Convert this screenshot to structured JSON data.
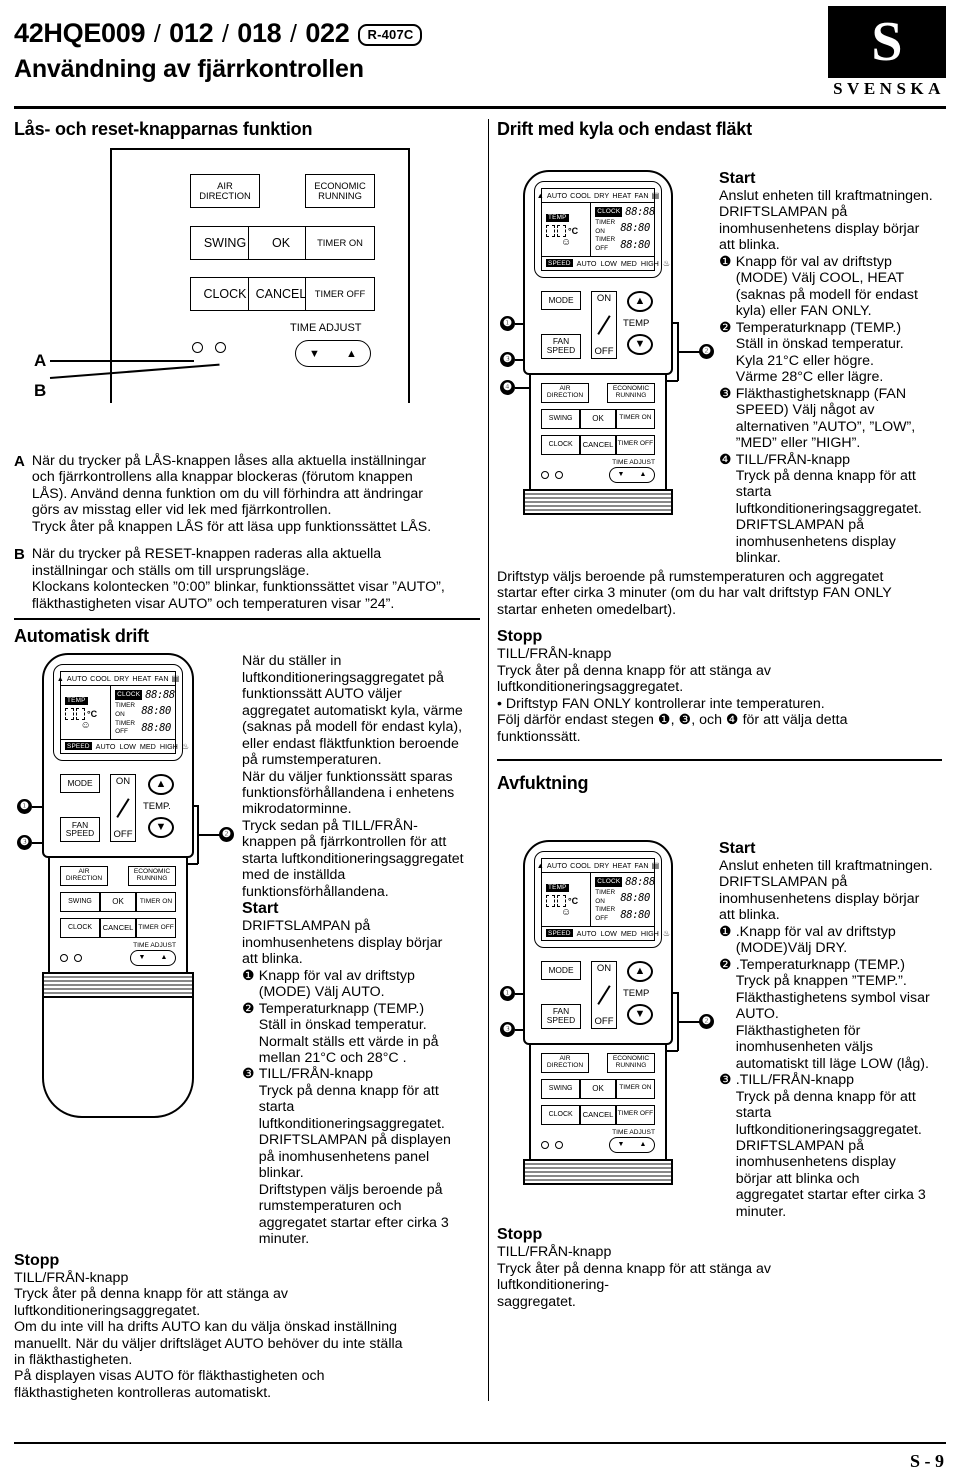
{
  "header": {
    "model": "42HQE009 / 012 / 018 / 022",
    "model_parts": [
      "42HQE009",
      "012",
      "018",
      "022"
    ],
    "refrigerant": "R-407C",
    "subtitle": "Användning av fjärrkontrollen",
    "logo_letter": "S",
    "logo_word": "SVENSKA"
  },
  "left": {
    "section1_title": "Lås- och reset-knapparnas funktion",
    "lock_panel": {
      "buttons": [
        "AIR DIRECTION",
        "ECONOMIC RUNNING",
        "SWING",
        "OK",
        "TIMER ON",
        "CLOCK",
        "CANCEL",
        "TIMER OFF"
      ],
      "air_direction": "AIR\nDIRECTION",
      "economic_running": "ECONOMIC\nRUNNING",
      "swing": "SWING",
      "ok": "OK",
      "timer_on": "TIMER ON",
      "clock": "CLOCK",
      "cancel": "CANCEL",
      "timer_off": "TIMER OFF",
      "time_adjust": "TIME ADJUST",
      "arrow_down": "▼",
      "arrow_up": "▲",
      "label_a": "A",
      "label_b": "B"
    },
    "note_a_label": "A",
    "note_a": "När du trycker på LÅS-knappen låses alla aktuella inställningar\noch fjärrkontrollens alla knappar blockeras (förutom knappen\nLÅS). Använd denna funktion om du vill förhindra att  ändringar\ngörs av misstag eller vid lek med fjärrkontrollen.\nTryck  åter på  knappen LÅS för att läsa upp funktionssättet LÅS.",
    "note_b_label": "B",
    "note_b": "När du trycker på  RESET-knappen raderas alla aktuella\ninställningar och ställs om till ursprungsläge.\nKlockans kolontecken ”0:00” blinkar, funktionssättet visar ”AUTO”,\nfläkthastigheten visar  AUTO” och temperaturen visar ”24”.",
    "section2_title": "Automatisk drift",
    "auto_intro": "När du ställer in\nluftkonditioneringsaggregatet på\nfunktionssätt AUTO väljer\naggregatet automatiskt kyla, värme\n(saknas på  modell för endast kyla),\neller endast fläktfunktion beroende\npå  rumstemperaturen.\nNär du väljer funktionssätt sparas\nfunktionsförhållandena i enhetens\nmikrodatorminne.\nTryck sedan på  TILL/FRÅN-\nknappen på  fjärrkontrollen för att\nstarta  luftkonditioneringsaggregatet\nmed de inställda\nfunktionsförhållandena.",
    "start_label": "Start",
    "start_intro": "DRIFTSLAMPAN på\ninomhusenhetens display börjar\natt blinka.",
    "steps": [
      {
        "num": "❶",
        "text": "Knapp för val av driftstyp\n(MODE) Välj AUTO."
      },
      {
        "num": "❷",
        "text": "Temperaturknapp (TEMP.)\n Ställ in  önskad temperatur.\nNormalt ställs ett värde in på\nmellan 21°C och 28°C ."
      },
      {
        "num": "❸",
        "text": "TILL/FRÅN-knapp\nTryck på  denna knapp för att\nstarta\nluftkonditioneringsaggregatet.\nDRIFTSLAMPAN på displayen\npå inomhusenhetens panel\nblinkar.\nDriftstypen väljs beroende på\nrumstemperaturen och\naggregatet startar efter cirka 3\nminuter."
      }
    ],
    "stop_label": "Stopp",
    "stop_text": "TILL/FRÅN-knapp\nTryck  åter på  denna knapp för att stänga av\nluftkonditioneringsaggregatet.\nOm du inte vill ha drifts AUTO kan du välja önskad inställning\nmanuellt. När du väljer driftsläget AUTO behöver du inte ställa\nin fläkthastigheten.\nPå  displayen visas AUTO för fläkthastigheten och\nfläkthastigheten kontrolleras automatiskt."
  },
  "right": {
    "section1_title": "Drift med kyla och endast fläkt",
    "start_label": "Start",
    "start_intro": "Anslut enheten till kraftmatningen.\nDRIFTSLAMPAN på\ninomhusenhetens display börjar\natt blinka.",
    "steps": [
      {
        "num": "❶",
        "text": "Knapp för val av driftstyp\n(MODE) Välj COOL, HEAT\n(saknas på  modell för endast\nkyla) eller FAN ONLY."
      },
      {
        "num": "❷",
        "text": "Temperaturknapp (TEMP.)\nStäll in  önskad temperatur.\nKyla 21°C  eller högre.\nVärme 28°C  eller lägre."
      },
      {
        "num": "❸",
        "text": "Fläkthastighetsknapp (FAN\nSPEED) Välj något av\nalternativen ”AUTO”, ”LOW”,\n”MED” eller ”HIGH”."
      },
      {
        "num": "❹",
        "text": "TILL/FRÅN-knapp\nTryck på  denna knapp för att\nstarta\nluftkonditioneringsaggregatet.\nDRIFTSLAMPAN på\ninomhusenhetens display\nblinkar."
      }
    ],
    "after_steps": "Driftstyp väljs beroende på  rumstemperaturen och aggregatet\nstartar efter cirka 3 minuter (om du har valt driftstyp FAN ONLY\nstartar enheten omedelbart).",
    "stop_label": "Stopp",
    "stop_text": "TILL/FRÅN-knapp\nTryck åter på  denna knapp för att stänga av\nluftkonditioneringsaggregatet.",
    "stop_bullet": "• Driftstyp FAN ONLY kontrollerar inte temperaturen.\n  Följ därför endast stegen ❶, ❸, och ❹ för att välja detta\n  funktionssätt.",
    "section2_title": "Avfuktning",
    "dry_start_label": "Start",
    "dry_start_intro": "Anslut enheten till kraftmatningen.\nDRIFTSLAMPAN på\ninomhusenhetens display börjar\natt blinka.",
    "dry_steps": [
      {
        "num": "❶",
        "text": ".Knapp för val av driftstyp\n(MODE)Välj DRY."
      },
      {
        "num": "❷",
        "text": ".Temperaturknapp (TEMP.)\nTryck på  knappen ”TEMP.”.\nFläkthastighetens symbol visar\nAUTO.\nFläkthastigheten för\ninomhusenheten väljs\nautomatiskt till läge LOW (låg)."
      },
      {
        "num": "❸",
        "text": ".TILL/FRÅN-knapp\nTryck på  denna knapp för att\nstarta\nluftkonditioneringsaggregatet.\nDRIFTSLAMPAN på\ninomhusenhetens display\nbörjar att blinka och\naggregatet startar efter cirka 3\nminuter."
      }
    ],
    "dry_stop_label": "Stopp",
    "dry_stop_text": "TILL/FRÅN-knapp\nTryck  åter på  denna knapp för att stänga av\nluftkonditionering-\nsaggregatet."
  },
  "remote": {
    "lcd": {
      "modes": [
        "AUTO",
        "COOL",
        "DRY",
        "HEAT",
        "FAN"
      ],
      "mode_arrow": "▲",
      "signal_icon": "signal-icon",
      "temp_tag": "TEMP",
      "temp_digits": "88",
      "unit": "°C",
      "smiley": "☺",
      "clock_tag": "CLOCK",
      "clock_value": "88:88",
      "timer_on_label": "TIMER ON",
      "timer_on_value": "88:80",
      "timer_off_label": "TIMER OFF",
      "timer_off_value": "88:80",
      "speed_tag": "SPEED",
      "speeds": [
        "AUTO",
        "LOW",
        "MED",
        "HIGH"
      ],
      "fan_icon": "fan-icon"
    },
    "buttons": {
      "mode": "MODE",
      "fan_speed": "FAN\nSPEED",
      "on": "ON",
      "off": "OFF",
      "temp": "TEMP",
      "temp_dot": "TEMP.",
      "up": "▲",
      "down": "▼",
      "air_direction": "AIR\nDIRECTION",
      "economic_running": "ECONOMIC\nRUNNING",
      "swing": "SWING",
      "ok": "OK",
      "timer_on": "TIMER ON",
      "clock": "CLOCK",
      "cancel": "CANCEL",
      "timer_off": "TIMER OFF",
      "time_adjust": "TIME ADJUST"
    },
    "callouts": {
      "one": "❶",
      "two": "❷",
      "three": "❸",
      "four": "❹"
    }
  },
  "footer": {
    "page_number": "S - 9"
  }
}
